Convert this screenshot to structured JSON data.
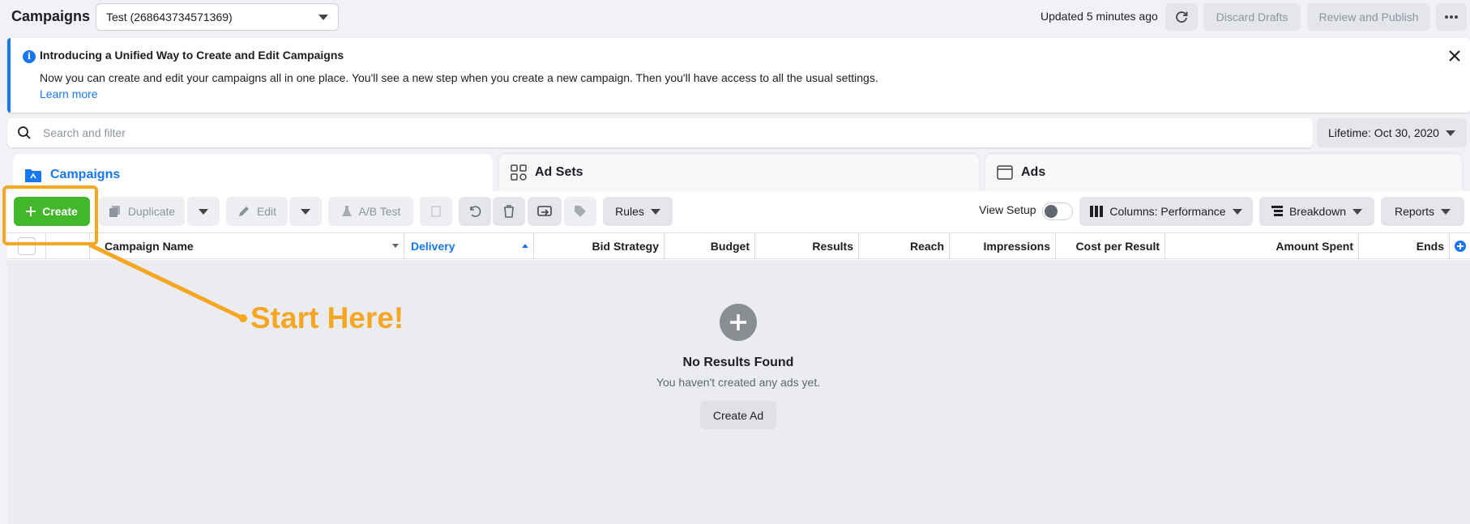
{
  "header": {
    "title": "Campaigns",
    "account": "Test (268643734571369)",
    "updated": "Updated 5 minutes ago",
    "discard_label": "Discard Drafts",
    "review_label": "Review and Publish"
  },
  "banner": {
    "title": "Introducing a Unified Way to Create and Edit Campaigns",
    "text": "Now you can create and edit your campaigns all in one place. You'll see a new step when you create a new campaign. Then you'll have access to all the usual settings.",
    "link": "Learn more"
  },
  "search": {
    "placeholder": "Search and filter",
    "date_range": "Lifetime: Oct 30, 2020"
  },
  "tabs": [
    {
      "label": "Campaigns"
    },
    {
      "label": "Ad Sets"
    },
    {
      "label": "Ads"
    }
  ],
  "toolbar": {
    "create": "Create",
    "duplicate": "Duplicate",
    "edit": "Edit",
    "ab_test": "A/B Test",
    "rules": "Rules",
    "view_setup": "View Setup",
    "columns": "Columns: Performance",
    "breakdown": "Breakdown",
    "reports": "Reports"
  },
  "table": {
    "columns": [
      "Campaign Name",
      "Delivery",
      "Bid Strategy",
      "Budget",
      "Results",
      "Reach",
      "Impressions",
      "Cost per Result",
      "Amount Spent",
      "Ends"
    ]
  },
  "empty_state": {
    "title": "No Results Found",
    "subtitle": "You haven't created any ads yet.",
    "button": "Create Ad"
  },
  "annotation": {
    "text": "Start Here!",
    "color": "#f5a623"
  },
  "colors": {
    "accent": "#1877f2",
    "create_green": "#42b72a"
  }
}
